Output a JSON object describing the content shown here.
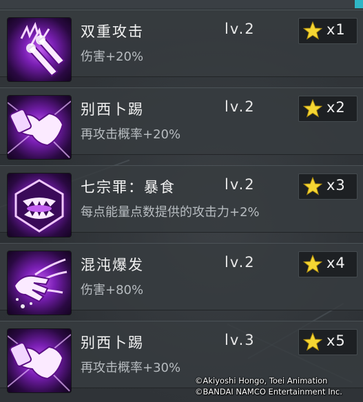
{
  "skills": [
    {
      "name": "双重攻击",
      "level": "lv.2",
      "effect": "伤害+20%",
      "quantity": "x1",
      "icon": "twin-missile-icon"
    },
    {
      "name": "别西卜踢",
      "level": "lv.2",
      "effect": "再攻击概率+20%",
      "quantity": "x2",
      "icon": "kick-icon"
    },
    {
      "name": "七宗罪：暴食",
      "level": "lv.2",
      "effect": "每点能量点数提供的攻击力+2%",
      "quantity": "x3",
      "icon": "fanged-maw-icon"
    },
    {
      "name": "混沌爆发",
      "level": "lv.2",
      "effect": "伤害+80%",
      "quantity": "x4",
      "icon": "claw-burst-icon"
    },
    {
      "name": "别西卜踢",
      "level": "lv.3",
      "effect": "再攻击概率+30%",
      "quantity": "x5",
      "icon": "kick-icon"
    }
  ],
  "copyright": {
    "line1": "©Akiyoshi Hongo, Toei Animation",
    "line2": "©BANDAI NAMCO Entertainment Inc."
  },
  "colors": {
    "icon_purple": "#a93ee0",
    "star_yellow": "#f5d633",
    "accent_cyan": "#2fb6c6"
  }
}
